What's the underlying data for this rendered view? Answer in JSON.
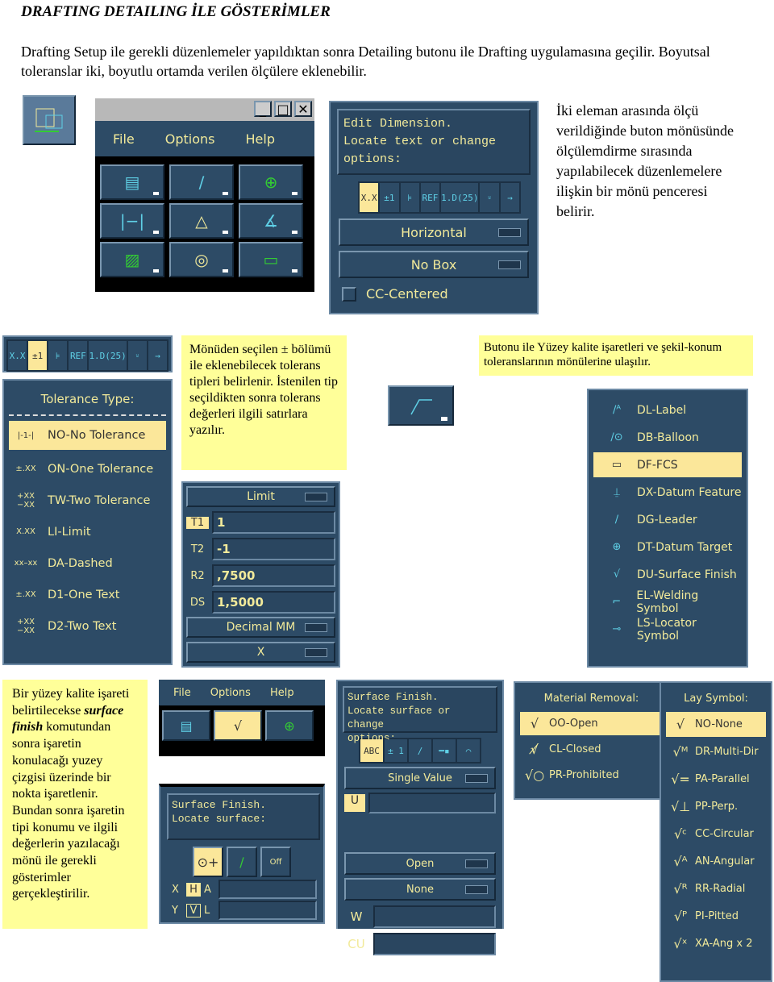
{
  "doc": {
    "title": "DRAFTING DETAILING İLE GÖSTERİMLER",
    "intro": "Drafting Setup ile gerekli düzenlemeler yapıldıktan sonra  Detailing butonu ile Drafting uygulamasına geçilir. Boyutsal toleranslar iki, boyutlu ortamda verilen ölçülere eklenebilir.",
    "note1": "İki eleman arasında ölçü verildiğinde buton mönüsünde ölçülemdirme sırasında yapılabilecek düzenlemelere ilişkin bir mönü penceresi belirir.",
    "note2": "Mönüden seçilen  ± bölümü  ile eklenebilecek tolerans tipleri belirlenir. İstenilen tip seçildikten sonra  tolerans değerleri ilgili satırlara yazılır.",
    "note3": "Butonu ile Yüzey kalite işaretleri ve şekil-konum toleranslarının mönülerine ulaşılır.",
    "note4_a": "Bir yüzey kalite işareti belirtilecekse ",
    "note4_b": "surface finish",
    "note4_c": " komutundan sonra işaretin konulacağı yuzey çizgisi üzerinde bir nokta işaretlenir. Bundan sonra işaretin tipi konumu ve ilgili değerlerin yazılacağı mönü ile gerekli gösterimler gerçekleştirilir."
  },
  "menu": {
    "items": [
      "File",
      "Options",
      "Help"
    ]
  },
  "edit_dim": {
    "prompt": [
      "Edit Dimension.",
      "Locate text or change",
      "options:"
    ],
    "toolbar": [
      "X.X",
      "±1",
      "⊧",
      "REF",
      "1.D(25)",
      "⸚",
      "→"
    ],
    "orientation": "Horizontal",
    "box": "No Box",
    "check": "CC-Centered"
  },
  "tolerance": {
    "toolbar": [
      "X.X",
      "±1",
      "⊧",
      "REF",
      "1.D(25)",
      "⸚",
      "→"
    ],
    "heading": "Tolerance Type:",
    "items": [
      {
        "icon": "|-1-|",
        "label": "NO-No Tolerance"
      },
      {
        "icon": "±.XX",
        "label": "ON-One Tolerance"
      },
      {
        "icon": "+XX −XX",
        "label": "TW-Two Tolerance"
      },
      {
        "icon": "X.XX",
        "label": "LI-Limit"
      },
      {
        "icon": "xx–xx",
        "label": "DA-Dashed"
      },
      {
        "icon": "±.XX",
        "label": "D1-One Text"
      },
      {
        "icon": "+XX −XX",
        "label": "D2-Two Text"
      }
    ]
  },
  "limit": {
    "type": "Limit",
    "fields": [
      {
        "label": "T1",
        "value": "1"
      },
      {
        "label": "T2",
        "value": "-1"
      },
      {
        "label": "R2",
        "value": ",7500"
      },
      {
        "label": "DS",
        "value": "1,5000"
      }
    ],
    "units": "Decimal MM",
    "x": "X"
  },
  "symbols": {
    "items": [
      "DL-Label",
      "DB-Balloon",
      "DF-FCS",
      "DX-Datum Feature",
      "DG-Leader",
      "DT-Datum Target",
      "DU-Surface Finish",
      "EL-Welding Symbol",
      "LS-Locator Symbol"
    ],
    "selected": 2
  },
  "sf_small": {
    "prompt": [
      "Surface Finish.",
      "Locate surface:"
    ],
    "off": "Off",
    "rows": [
      {
        "a": "X",
        "b": "H",
        "c": "A"
      },
      {
        "a": "Y",
        "b": "V",
        "c": "L"
      }
    ]
  },
  "sf_right": {
    "prompt": [
      "Surface Finish.",
      "Locate surface or change",
      "options:"
    ],
    "toolbar": [
      "ABC",
      "± 1",
      "∕",
      "━▪",
      "⌒"
    ],
    "value_type": "Single Value",
    "u": "U",
    "removal": "Open",
    "lay": "None",
    "w": "W",
    "cu": "CU"
  },
  "material": {
    "heading": "Material Removal:",
    "items": [
      "OO-Open",
      "CL-Closed",
      "PR-Prohibited"
    ]
  },
  "lay": {
    "heading": "Lay Symbol:",
    "items": [
      "NO-None",
      "DR-Multi-Dir",
      "PA-Parallel",
      "PP-Perp.",
      "CC-Circular",
      "AN-Angular",
      "RR-Radial",
      "PI-Pitted",
      "XA-Ang x 2"
    ]
  },
  "colors": {
    "panel": "#2d4b66",
    "text": "#f2ea9a",
    "highlight": "#fbe79a",
    "callout": "#ffff99"
  }
}
